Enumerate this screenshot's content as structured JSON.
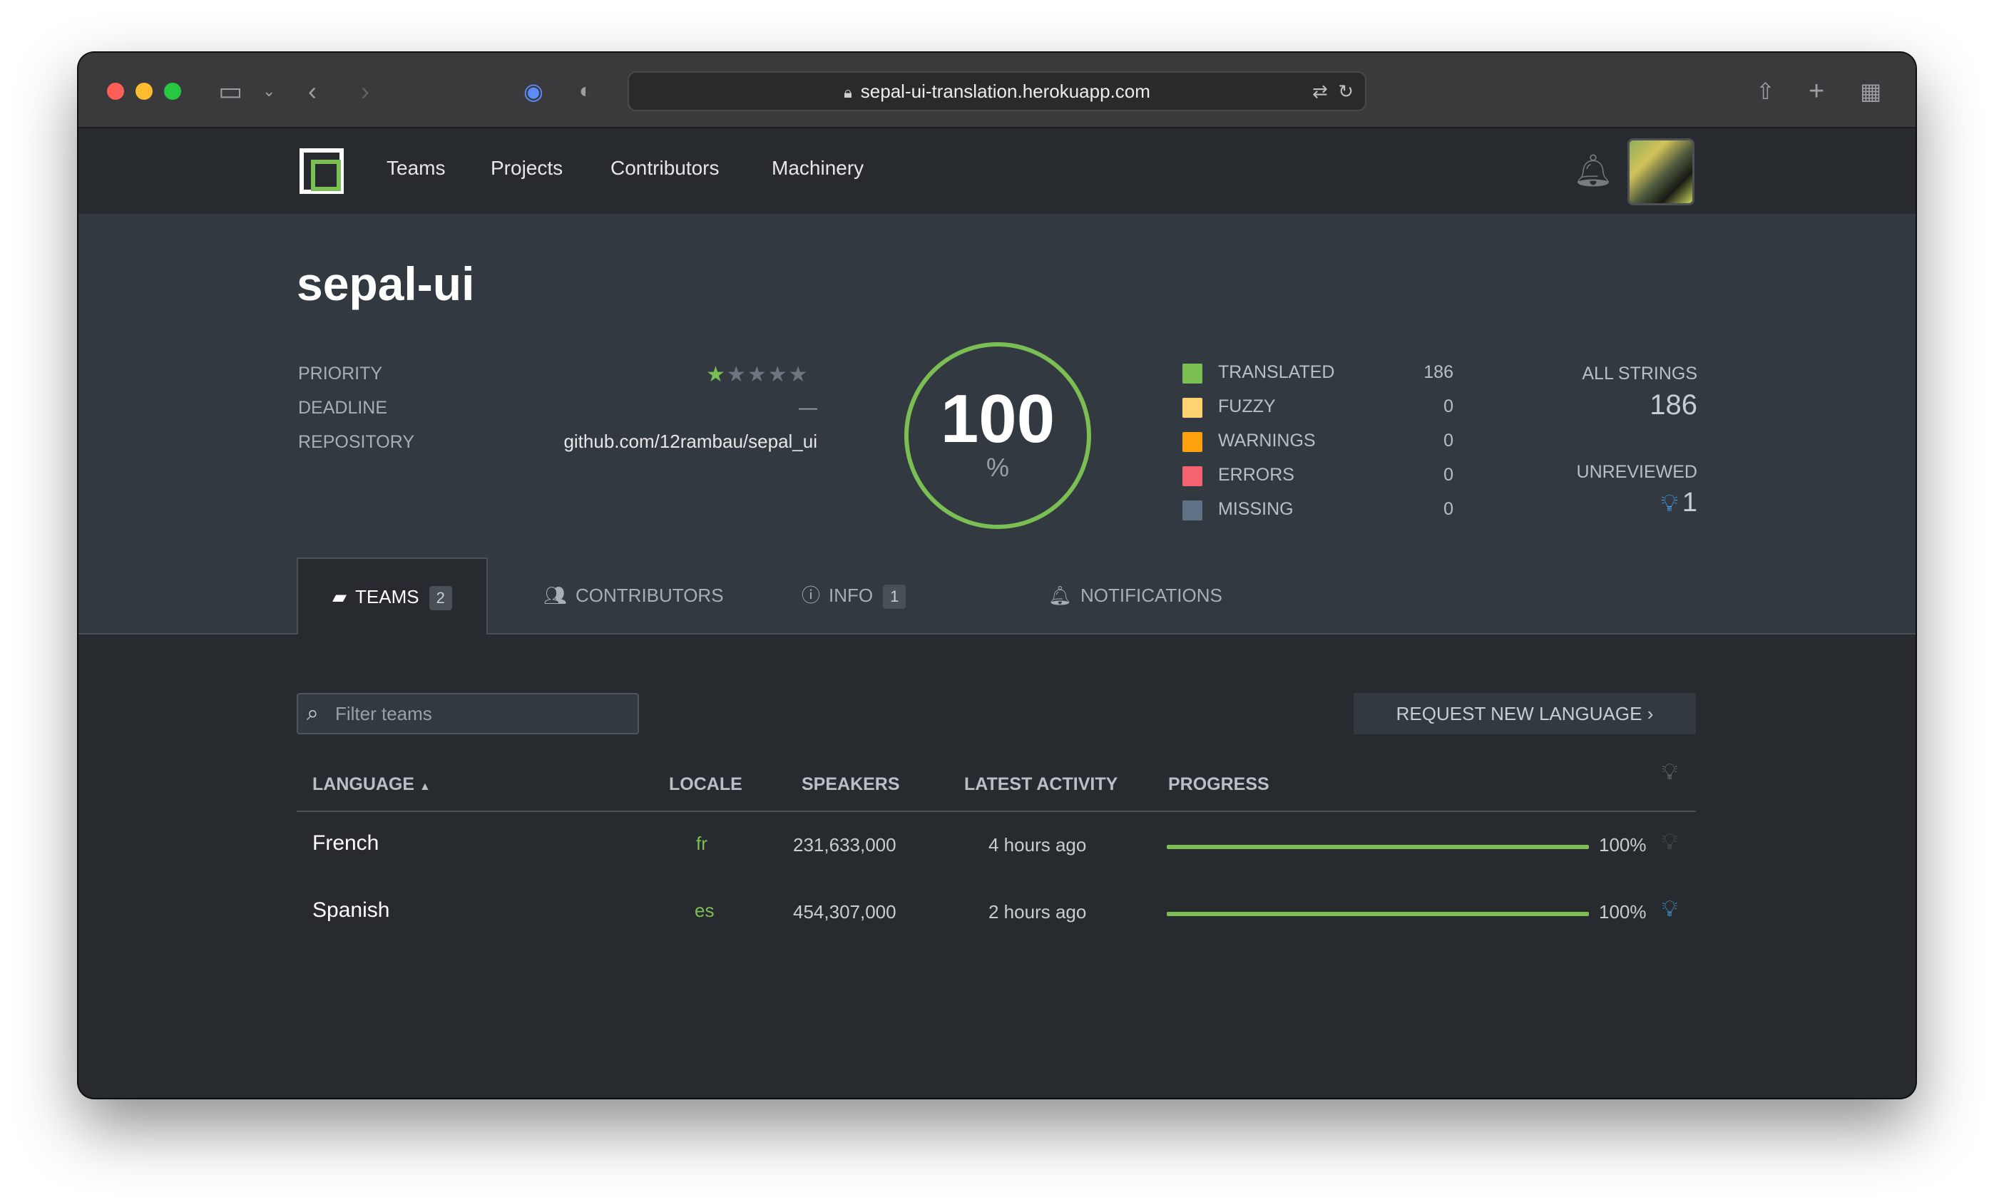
{
  "browser": {
    "url": "sepal-ui-translation.herokuapp.com"
  },
  "nav": {
    "links": [
      "Teams",
      "Projects",
      "Contributors",
      "Machinery"
    ]
  },
  "project": {
    "title": "sepal-ui",
    "priority_label": "PRIORITY",
    "priority_stars": 1,
    "priority_max": 5,
    "deadline_label": "DEADLINE",
    "deadline_value": "—",
    "repository_label": "REPOSITORY",
    "repository_value": "github.com/12rambau/sepal_ui",
    "progress_value": "100",
    "progress_symbol": "%"
  },
  "stats": [
    {
      "label": "TRANSLATED",
      "count": "186",
      "color": "#7bbe53"
    },
    {
      "label": "FUZZY",
      "count": "0",
      "color": "#fed271"
    },
    {
      "label": "WARNINGS",
      "count": "0",
      "color": "#ffa10f"
    },
    {
      "label": "ERRORS",
      "count": "0",
      "color": "#f36370"
    },
    {
      "label": "MISSING",
      "count": "0",
      "color": "#5f7285"
    }
  ],
  "summary": {
    "all_strings_label": "ALL STRINGS",
    "all_strings_value": "186",
    "unreviewed_label": "UNREVIEWED",
    "unreviewed_value": "1"
  },
  "tabs": [
    {
      "label": "TEAMS",
      "badge": "2",
      "icon": "folder-icon"
    },
    {
      "label": "CONTRIBUTORS",
      "icon": "users-icon"
    },
    {
      "label": "INFO",
      "badge": "1",
      "icon": "info-icon"
    },
    {
      "label": "NOTIFICATIONS",
      "icon": "bell-icon"
    }
  ],
  "controls": {
    "filter_placeholder": "Filter teams",
    "request_button": "REQUEST NEW LANGUAGE"
  },
  "table": {
    "headers": [
      "LANGUAGE",
      "LOCALE",
      "SPEAKERS",
      "LATEST ACTIVITY",
      "PROGRESS"
    ],
    "rows": [
      {
        "language": "French",
        "locale": "fr",
        "speakers": "231,633,000",
        "activity": "4 hours ago",
        "progress": "100%",
        "progress_fraction": 1.0,
        "unreviewed": false
      },
      {
        "language": "Spanish",
        "locale": "es",
        "speakers": "454,307,000",
        "activity": "2 hours ago",
        "progress": "100%",
        "progress_fraction": 1.0,
        "unreviewed": true
      }
    ]
  }
}
